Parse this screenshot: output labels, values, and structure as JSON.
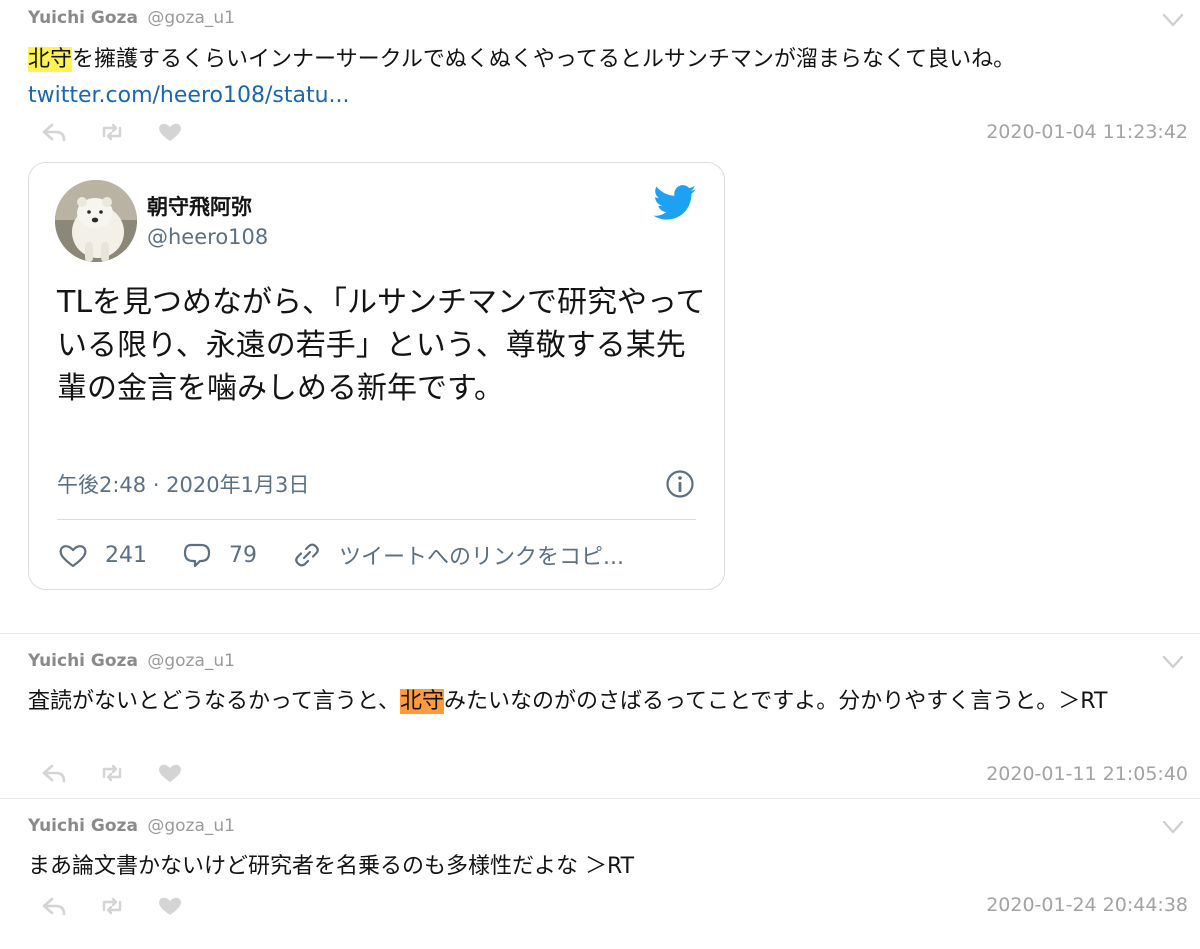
{
  "tweets": [
    {
      "author_name": "Yuichi Goza",
      "author_handle": "@goza_u1",
      "highlight": "北守",
      "text_after": "を擁護するくらいインナーサークルでぬくぬくやってるとルサンチマンが溜まらなくて良いね。",
      "link": "twitter.com/heero108/statu...",
      "timestamp": "2020-01-04 11:23:42"
    },
    {
      "author_name": "Yuichi Goza",
      "author_handle": "@goza_u1",
      "text_before": "査読がないとどうなるかって言うと、",
      "highlight": "北守",
      "text_after": "みたいなのがのさばるってことですよ。分かりやすく言うと。＞RT",
      "timestamp": "2020-01-11 21:05:40"
    },
    {
      "author_name": "Yuichi Goza",
      "author_handle": "@goza_u1",
      "text": "まあ論文書かないけど研究者を名乗るのも多様性だよな ＞RT",
      "timestamp": "2020-01-24 20:44:38"
    }
  ],
  "embedded": {
    "display_name": "朝守飛阿弥",
    "handle": "@heero108",
    "text": "TLを見つめながら、「ルサンチマンで研究やっている限り、永遠の若手」という、尊敬する某先輩の金言を噛みしめる新年です。",
    "meta": "午後2:48 · 2020年1月3日",
    "likes": "241",
    "replies": "79",
    "copy_link": "ツイートへのリンクをコピ..."
  },
  "icons": {
    "reply": "reply-icon",
    "retweet": "retweet-icon",
    "like": "heart-icon",
    "menu": "chevron-down-icon",
    "brand": "twitter-bird-icon",
    "info": "info-icon",
    "comment": "comment-icon",
    "link": "link-icon"
  },
  "colors": {
    "highlight_yellow": "#fff44f",
    "highlight_orange": "#ff9b3d",
    "link": "#1a66b3",
    "twitter_blue": "#1da1f2",
    "muted": "#a3a3a3"
  }
}
